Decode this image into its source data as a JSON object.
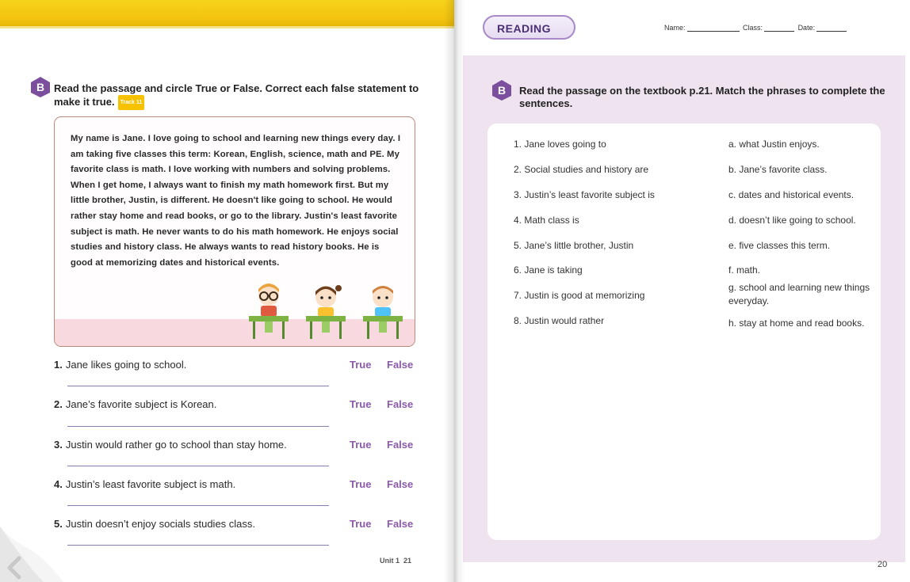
{
  "left_page": {
    "badge_letter": "B",
    "title": "Read the passage and circle True or False. Correct each false statement to make it true.",
    "track_label": "Track 11",
    "passage": "My name is Jane. I love going to school and learning new things every day. I am taking five classes this term: Korean, English, science, math and PE. My favorite class is math. I love working with numbers and solving problems. When I get home, I always want to finish my math homework first. But my little brother, Justin, is different. He doesn't like going to school. He would rather stay home and read books, or go to the library. Justin's least favorite subject is math. He never wants to do his math homework. He enjoys social studies and history class. He always wants to read history books. He is good at memorizing dates and historical events.",
    "questions": [
      {
        "num": "1.",
        "text": "Jane likes going to school.",
        "true_label": "True",
        "false_label": "False"
      },
      {
        "num": "2.",
        "text": "Jane’s favorite subject is Korean.",
        "true_label": "True",
        "false_label": "False"
      },
      {
        "num": "3.",
        "text": "Justin would rather go to school than stay home.",
        "true_label": "True",
        "false_label": "False"
      },
      {
        "num": "4.",
        "text": "Justin’s least favorite subject is math.",
        "true_label": "True",
        "false_label": "False"
      },
      {
        "num": "5.",
        "text": "Justin doesn’t enjoy socials studies class.",
        "true_label": "True",
        "false_label": "False"
      }
    ],
    "footer_unit": "Unit 1",
    "footer_page": "21"
  },
  "right_page": {
    "section_label": "READING",
    "name_label": "Name:",
    "class_label": "Class:",
    "date_label": "Date:",
    "badge_letter": "B",
    "title": "Read the passage on the textbook p.21. Match the phrases to complete the sentences.",
    "left_phrases": [
      "1. Jane loves going to",
      "2. Social studies and history are",
      "3. Justin’s least favorite subject is",
      "4. Math class is",
      "5. Jane’s little brother, Justin",
      "6. Jane is taking",
      "7. Justin is good at memorizing",
      "8. Justin would rather"
    ],
    "right_phrases": [
      "a. what Justin enjoys.",
      "b. Jane’s favorite class.",
      "c. dates and historical events.",
      "d. doesn’t like going to school.",
      "e. five classes this term.",
      "f. math.",
      "g. school and learning new things everyday.",
      "h. stay at home and read books."
    ],
    "page_number": "20"
  },
  "colors": {
    "accent_purple": "#8a5aa8",
    "badge_purple": "#7b4f9e",
    "panel_lilac": "#eee3ef",
    "band_yellow": "#f3c40f",
    "passage_border": "#b88a7a",
    "passage_pink": "#f7d9df"
  }
}
